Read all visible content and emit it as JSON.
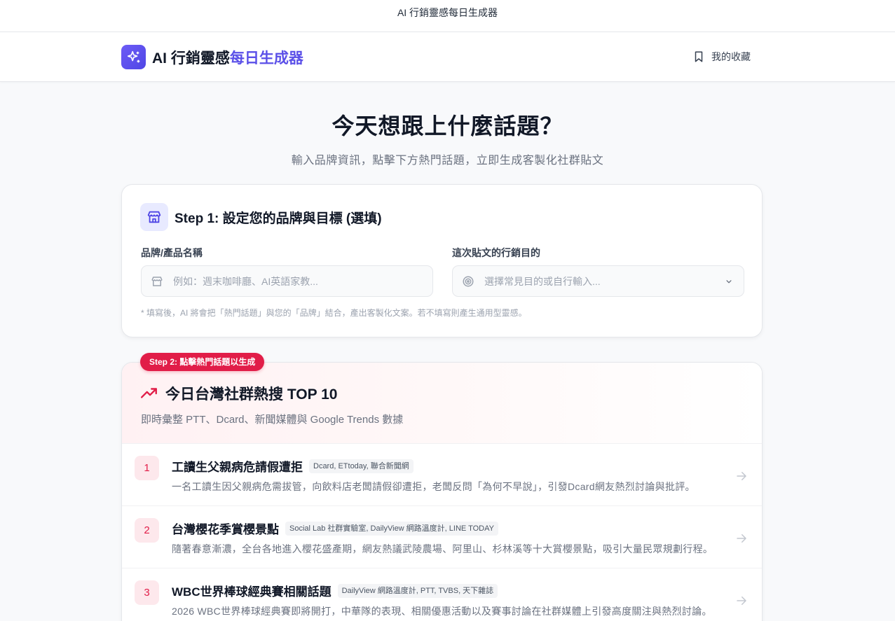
{
  "window": {
    "title": "AI 行銷靈感每日生成器"
  },
  "nav": {
    "brand_main": "AI 行銷靈感",
    "brand_accent": "每日生成器",
    "favorites_label": "我的收藏"
  },
  "hero": {
    "title": "今天想跟上什麼話題？",
    "subtitle": "輸入品牌資訊，點擊下方熱門話題，立即生成客製化社群貼文"
  },
  "step1": {
    "title": "Step 1: 設定您的品牌與目標 (選填)",
    "brand_label": "品牌/產品名稱",
    "brand_placeholder": "例如：週末咖啡廳、AI英語家教...",
    "goal_label": "這次貼文的行銷目的",
    "goal_placeholder": "選擇常見目的或自行輸入...",
    "hint": "* 填寫後，AI 將會把「熱門話題」與您的「品牌」結合，產出客製化文案。若不填寫則產生通用型靈感。"
  },
  "step2": {
    "badge": "Step 2: 點擊熱門話題以生成",
    "title": "今日台灣社群熱搜 TOP 10",
    "subtitle": "即時彙整 PTT、Dcard、新聞媒體與 Google Trends 數據",
    "topics": [
      {
        "rank": "1",
        "title": "工讀生父親病危請假遭拒",
        "sources": "Dcard, ETtoday, 聯合新聞網",
        "desc": "一名工讀生因父親病危需拔管，向飲料店老闆請假卻遭拒，老闆反問「為何不早說」，引發Dcard網友熱烈討論與批評。"
      },
      {
        "rank": "2",
        "title": "台灣櫻花季賞櫻景點",
        "sources": "Social Lab 社群實驗室, DailyView 網路溫度計, LINE TODAY",
        "desc": "隨著春意漸濃，全台各地進入櫻花盛產期，網友熱議武陵農場、阿里山、杉林溪等十大賞櫻景點，吸引大量民眾規劃行程。"
      },
      {
        "rank": "3",
        "title": "WBC世界棒球經典賽相關話題",
        "sources": "DailyView 網路溫度計, PTT, TVBS, 天下雜誌",
        "desc": "2026 WBC世界棒球經典賽即將開打，中華隊的表現、相關優惠活動以及賽事討論在社群媒體上引發高度關注與熱烈討論。"
      }
    ]
  },
  "colors": {
    "brand": "#5b50e8",
    "accent_red": "#e11d48",
    "rank_bg": "#fde8ec"
  }
}
